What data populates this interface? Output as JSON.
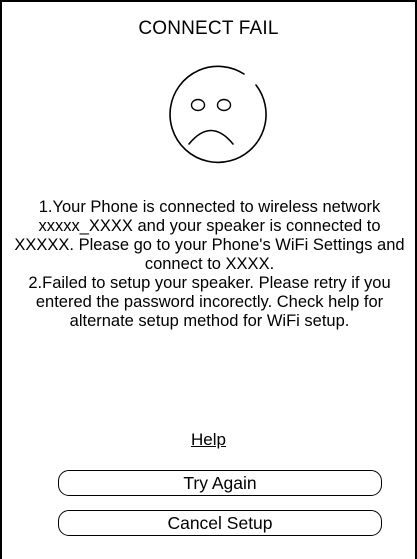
{
  "dialog": {
    "title": "CONNECT FAIL",
    "icon": "sad-face-icon",
    "message_1": "1.Your Phone is connected to wireless network xxxxx_XXXX and your speaker is connected to XXXXX. Please go to your Phone's WiFi Settings and connect to XXXX.",
    "message_2": "2.Failed to setup your speaker. Please retry if you entered the password incorectly. Check help for alternate setup method for WiFi setup.",
    "help_label": "Help",
    "try_again_label": "Try Again",
    "cancel_setup_label": "Cancel Setup"
  },
  "colors": {
    "background": "#ffffff",
    "foreground": "#000000"
  }
}
